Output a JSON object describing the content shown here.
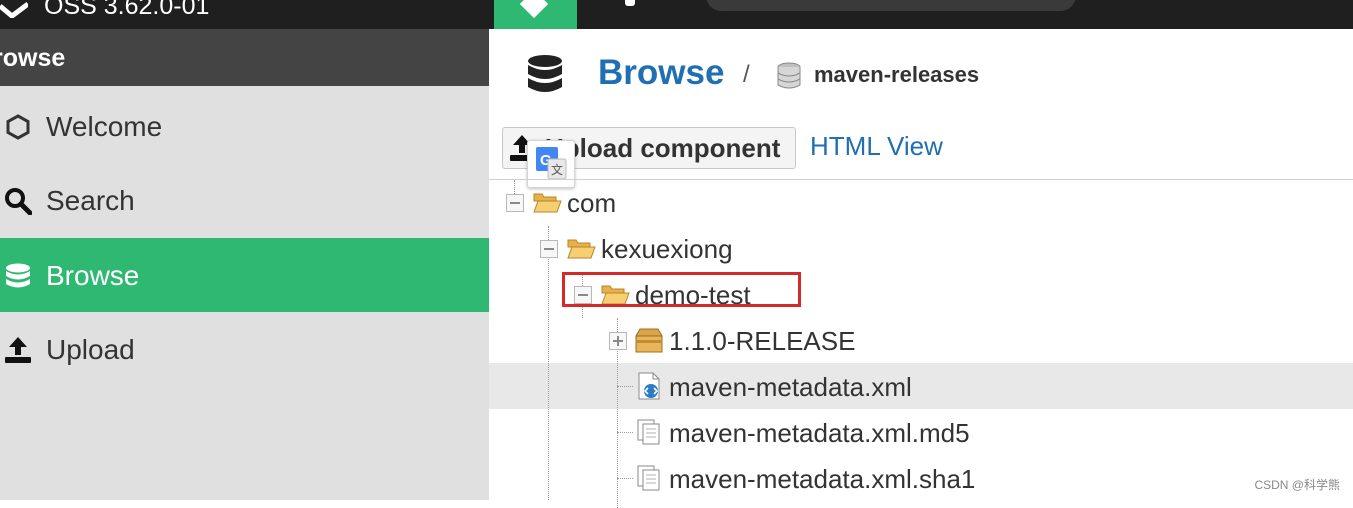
{
  "topbar": {
    "version": "OSS 3.62.0-01"
  },
  "sidebar": {
    "header": "rowse",
    "items": [
      {
        "label": "Welcome",
        "icon": "hexagon-icon",
        "active": false
      },
      {
        "label": "Search",
        "icon": "magnifier-icon",
        "active": false
      },
      {
        "label": "Browse",
        "icon": "database-icon",
        "active": true
      },
      {
        "label": "Upload",
        "icon": "upload-icon",
        "active": false
      }
    ]
  },
  "main": {
    "title": "Browse",
    "separator": "/",
    "repository": "maven-releases",
    "upload_button": "Upload component",
    "html_view": "HTML View"
  },
  "tree": [
    {
      "label": "com",
      "level": 0,
      "type": "folder-open",
      "toggle": "minus"
    },
    {
      "label": "kexuexiong",
      "level": 1,
      "type": "folder-open",
      "toggle": "minus"
    },
    {
      "label": "demo-test",
      "level": 2,
      "type": "folder-open",
      "toggle": "minus",
      "highlighted": true
    },
    {
      "label": "1.1.0-RELEASE",
      "level": 3,
      "type": "package",
      "toggle": "plus"
    },
    {
      "label": "maven-metadata.xml",
      "level": 3,
      "type": "xml-file",
      "selected": true
    },
    {
      "label": "maven-metadata.xml.md5",
      "level": 3,
      "type": "file"
    },
    {
      "label": "maven-metadata.xml.sha1",
      "level": 3,
      "type": "file"
    }
  ],
  "watermark": "CSDN @科学熊",
  "colors": {
    "accent_green": "#2eb872",
    "link_blue": "#1f6fb2",
    "highlight_red": "#d42a2a",
    "topbar_dark": "#1f1f1f",
    "sidebar_header": "#444444"
  }
}
